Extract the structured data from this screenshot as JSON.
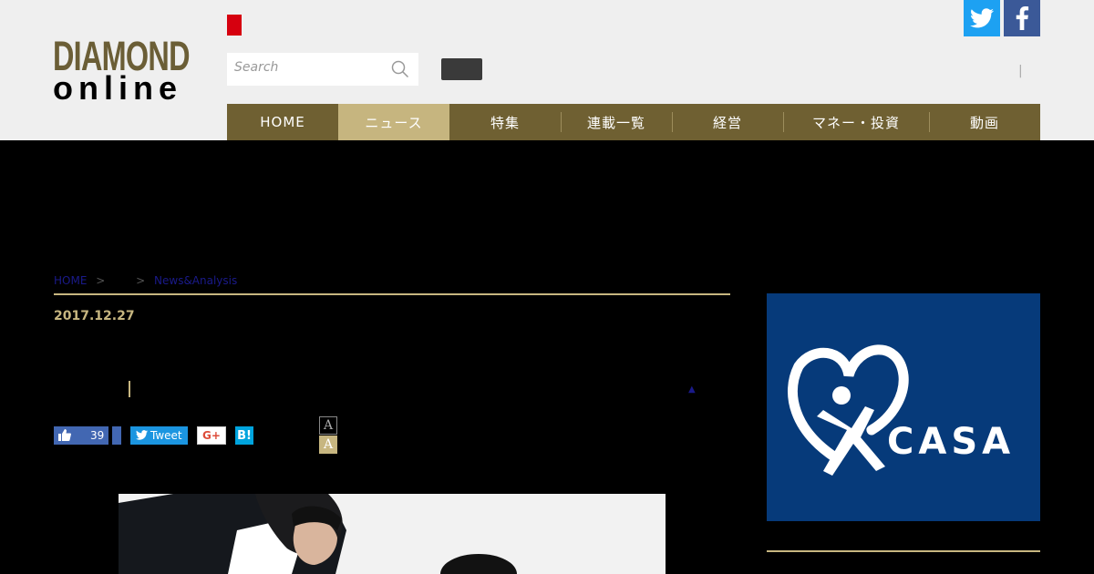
{
  "brand": {
    "line1": "DIAMOND",
    "line2": "online"
  },
  "colors": {
    "brand_gold": "#6f6032",
    "accent_gold": "#c7b680",
    "twitter": "#1da1f2",
    "facebook": "#3b5998"
  },
  "header": {
    "search_placeholder": "Search",
    "divider": "|",
    "sns": [
      {
        "icon": "twitter-icon"
      },
      {
        "icon": "facebook-icon"
      }
    ]
  },
  "nav": {
    "items": [
      {
        "label": "HOME"
      },
      {
        "label": "ニュース"
      },
      {
        "label": "特集"
      },
      {
        "label": "連載一覧"
      },
      {
        "label": "経営"
      },
      {
        "label": "マネー・投資"
      },
      {
        "label": "動画"
      }
    ]
  },
  "breadcrumb": {
    "home": "HOME",
    "sep": ">",
    "current": "News&Analysis"
  },
  "article": {
    "date": "2017.12.27",
    "scroll_marker": "▲"
  },
  "social": {
    "like_count": "39",
    "tweet_label": "Tweet",
    "gplus_label": "G+",
    "hatena_label": "B!",
    "font_small": "A",
    "font_large": "A"
  },
  "ad": {
    "brand_text": "CASA",
    "registered": "®"
  }
}
